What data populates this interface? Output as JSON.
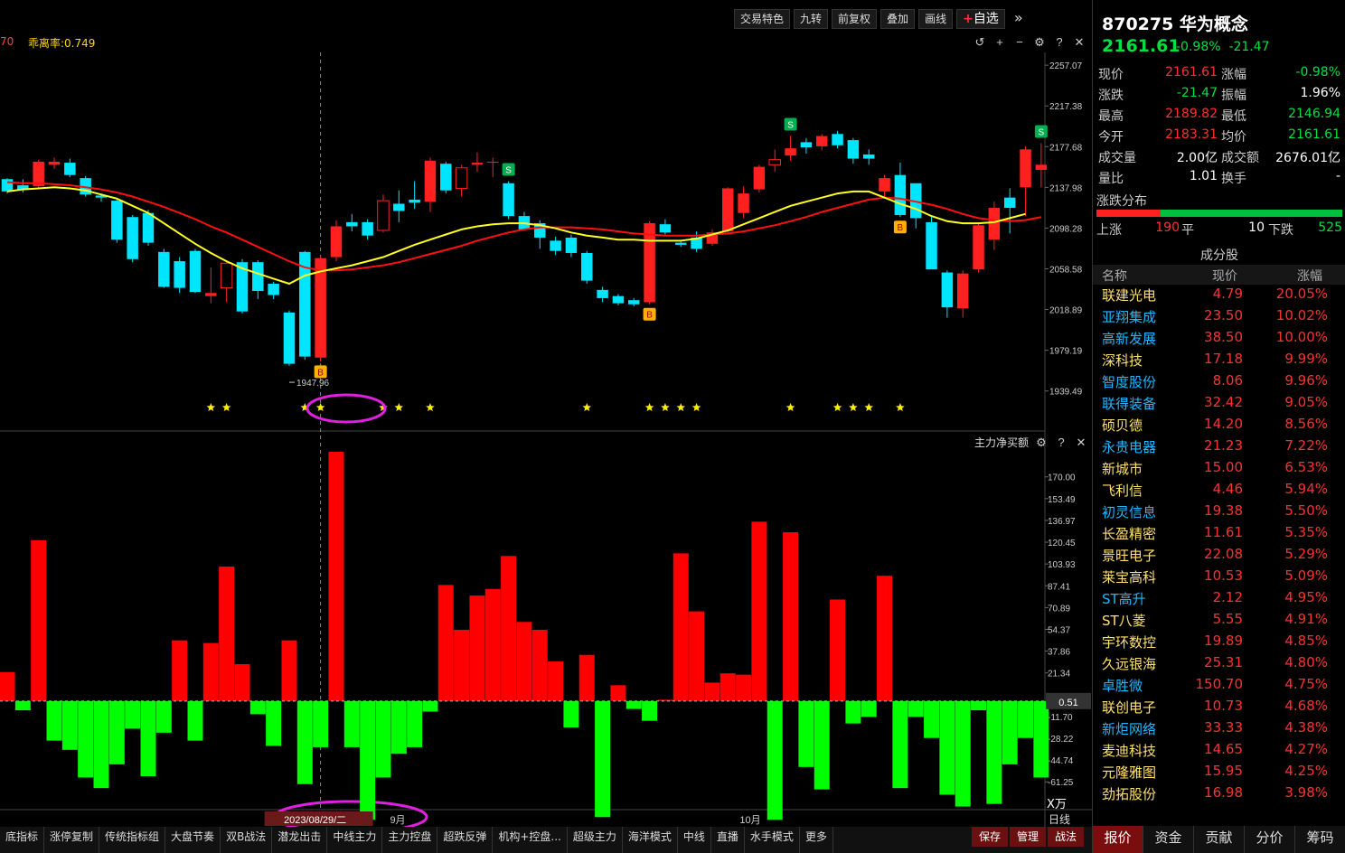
{
  "toolbar": {
    "items": [
      "交易特色",
      "九转",
      "前复权",
      "叠加",
      "画线"
    ],
    "fav_label": "自选",
    "more": "»"
  },
  "indicator_label": "乖离率:0.749",
  "indicator_prefix": "70",
  "volume_panel_label": "主力净买额",
  "date_selected": "2023/08/29/二",
  "month_labels": [
    "9月",
    "10月"
  ],
  "unit_label": "X万",
  "zero_label": "0.51",
  "period_label": "日线",
  "chart_data": [
    {
      "type": "candlestick",
      "y_ticks": [
        2257.07,
        2217.38,
        2177.68,
        2137.98,
        2098.28,
        2058.58,
        2018.89,
        1979.19,
        1939.49
      ],
      "ylim": [
        1926,
        2266
      ],
      "low_annotation": "1947.96",
      "ohlc": [
        [
          2146,
          2147,
          2132,
          2134
        ],
        [
          2140,
          2146,
          2133,
          2136
        ],
        [
          2139,
          2165,
          2137,
          2163
        ],
        [
          2160,
          2167,
          2156,
          2163
        ],
        [
          2162,
          2166,
          2148,
          2150
        ],
        [
          2147,
          2149,
          2129,
          2131
        ],
        [
          2130,
          2132,
          2124,
          2128
        ],
        [
          2125,
          2126,
          2084,
          2087
        ],
        [
          2109,
          2111,
          2065,
          2068
        ],
        [
          2113,
          2116,
          2081,
          2084
        ],
        [
          2075,
          2078,
          2040,
          2041
        ],
        [
          2066,
          2070,
          2035,
          2040
        ],
        [
          2076,
          2078,
          2035,
          2036
        ],
        [
          2032,
          2060,
          2025,
          2035
        ],
        [
          2040,
          2067,
          2026,
          2064
        ],
        [
          2065,
          2068,
          2015,
          2017
        ],
        [
          2065,
          2067,
          2029,
          2037
        ],
        [
          2044,
          2046,
          2029,
          2033
        ],
        [
          2016,
          2018,
          1964,
          1966
        ],
        [
          2075,
          2076,
          1970,
          1973
        ],
        [
          1972,
          2071,
          1968,
          2069
        ],
        [
          2070,
          2106,
          2066,
          2100
        ],
        [
          2104,
          2112,
          2095,
          2100
        ],
        [
          2104,
          2107,
          2087,
          2091
        ],
        [
          2096,
          2131,
          2094,
          2125
        ],
        [
          2122,
          2135,
          2104,
          2115
        ],
        [
          2126,
          2144,
          2117,
          2123
        ],
        [
          2124,
          2167,
          2114,
          2164
        ],
        [
          2161,
          2163,
          2132,
          2135
        ],
        [
          2137,
          2160,
          2129,
          2157
        ],
        [
          2160,
          2172,
          2153,
          2162
        ],
        [
          2163,
          2167,
          2148,
          2163
        ],
        [
          2142,
          2144,
          2107,
          2110
        ],
        [
          2110,
          2114,
          2096,
          2097
        ],
        [
          2103,
          2106,
          2078,
          2089
        ],
        [
          2086,
          2090,
          2072,
          2076
        ],
        [
          2089,
          2092,
          2070,
          2074
        ],
        [
          2074,
          2076,
          2044,
          2047
        ],
        [
          2038,
          2041,
          2026,
          2030
        ],
        [
          2032,
          2034,
          2023,
          2025
        ],
        [
          2028,
          2030,
          2022,
          2024
        ],
        [
          2026,
          2105,
          2024,
          2103
        ],
        [
          2102,
          2107,
          2092,
          2094
        ],
        [
          2084,
          2086,
          2080,
          2082
        ],
        [
          2089,
          2095,
          2075,
          2078
        ],
        [
          2083,
          2097,
          2081,
          2094
        ],
        [
          2095,
          2138,
          2093,
          2137
        ],
        [
          2113,
          2139,
          2108,
          2132
        ],
        [
          2136,
          2160,
          2133,
          2158
        ],
        [
          2160,
          2175,
          2153,
          2165
        ],
        [
          2169,
          2188,
          2164,
          2176
        ],
        [
          2182,
          2186,
          2171,
          2177
        ],
        [
          2178,
          2190,
          2174,
          2188
        ],
        [
          2190,
          2193,
          2176,
          2179
        ],
        [
          2184,
          2186,
          2161,
          2166
        ],
        [
          2170,
          2175,
          2160,
          2166
        ],
        [
          2134,
          2150,
          2127,
          2147
        ],
        [
          2150,
          2162,
          2109,
          2111
        ],
        [
          2142,
          2133,
          2098,
          2108
        ],
        [
          2104,
          2110,
          2060,
          2058
        ],
        [
          2055,
          2057,
          2011,
          2021
        ],
        [
          2020,
          2057,
          2011,
          2054
        ],
        [
          2058,
          2104,
          2055,
          2101
        ],
        [
          2087,
          2124,
          2077,
          2118
        ],
        [
          2128,
          2137,
          2093,
          2118
        ],
        [
          2138,
          2178,
          2110,
          2175
        ],
        [
          2155,
          2181,
          2138,
          2160
        ]
      ],
      "ma_yellow": [
        2134,
        2136,
        2137,
        2138,
        2137,
        2135,
        2131,
        2127,
        2120,
        2113,
        2103,
        2093,
        2083,
        2074,
        2066,
        2059,
        2054,
        2049,
        2044,
        2052,
        2056,
        2059,
        2062,
        2066,
        2070,
        2076,
        2082,
        2087,
        2092,
        2097,
        2100,
        2102,
        2103,
        2103,
        2101,
        2098,
        2094,
        2091,
        2089,
        2087,
        2087,
        2086,
        2086,
        2086,
        2088,
        2092,
        2096,
        2102,
        2108,
        2114,
        2120,
        2124,
        2128,
        2132,
        2134,
        2134,
        2128,
        2122,
        2117,
        2110,
        2105,
        2103,
        2103,
        2104,
        2108,
        2112
      ],
      "ma_red": [
        2143,
        2142,
        2142,
        2141,
        2140,
        2138,
        2136,
        2133,
        2129,
        2124,
        2119,
        2113,
        2107,
        2100,
        2094,
        2087,
        2080,
        2073,
        2066,
        2060,
        2057,
        2057,
        2058,
        2060,
        2062,
        2065,
        2069,
        2073,
        2077,
        2081,
        2086,
        2090,
        2094,
        2097,
        2099,
        2099,
        2099,
        2098,
        2097,
        2095,
        2093,
        2092,
        2091,
        2091,
        2091,
        2092,
        2093,
        2095,
        2098,
        2101,
        2105,
        2109,
        2114,
        2118,
        2122,
        2126,
        2128,
        2127,
        2124,
        2121,
        2117,
        2112,
        2108,
        2106,
        2105,
        2106,
        2109
      ],
      "signals": [
        {
          "i": 20,
          "tag": "B"
        },
        {
          "i": 32,
          "tag": "S"
        },
        {
          "i": 41,
          "tag": "B"
        },
        {
          "i": 50,
          "tag": "S"
        },
        {
          "i": 57,
          "tag": "B"
        },
        {
          "i": 66,
          "tag": "S"
        }
      ],
      "stars": [
        13,
        14,
        19,
        20,
        24,
        25,
        27,
        37,
        41,
        42,
        43,
        44,
        50,
        53,
        54,
        55,
        57
      ]
    },
    {
      "type": "bar",
      "y_ticks": [
        170.0,
        153.49,
        136.97,
        120.45,
        103.93,
        87.41,
        70.89,
        54.37,
        37.86,
        21.34,
        -11.7,
        -28.22,
        -44.74,
        -61.25
      ],
      "ylim": [
        -70,
        189
      ],
      "values": [
        22,
        -7,
        122,
        -30,
        -37,
        -58,
        -66,
        -48,
        -21,
        -57,
        -24,
        46,
        -30,
        44,
        102,
        28,
        -10,
        -34,
        46,
        -63,
        -35,
        189,
        -35,
        -90,
        -58,
        -40,
        -35,
        -8,
        88,
        54,
        80,
        85,
        110,
        60,
        54,
        30,
        -20,
        35,
        -88,
        12,
        -6,
        -15,
        1,
        112,
        68,
        14,
        21,
        20,
        136,
        -90,
        128,
        -50,
        -67,
        77,
        -17,
        -12,
        95,
        -66,
        -12,
        -28,
        -71,
        -80,
        -7,
        -78,
        -48,
        -28,
        -58
      ]
    }
  ],
  "quote": {
    "code_name": "870275 华为概念",
    "price": "2161.61",
    "chg_pct": "-0.98%",
    "chg": "-21.47",
    "rows": [
      [
        "现价",
        "2161.61",
        "涨幅",
        "-0.98%"
      ],
      [
        "涨跌",
        "-21.47",
        "振幅",
        "1.96%"
      ],
      [
        "最高",
        "2189.82",
        "最低",
        "2146.94"
      ],
      [
        "今开",
        "2183.31",
        "均价",
        "2161.61"
      ],
      [
        "成交量",
        "2.00亿",
        "成交额",
        "2676.01亿"
      ],
      [
        "量比",
        "1.01",
        "换手",
        "-"
      ]
    ],
    "dist_title": "涨跌分布",
    "up_label": "上涨",
    "up": "190",
    "flat_label": "平",
    "flat": "10",
    "down_label": "下跌",
    "down": "525"
  },
  "components": {
    "title": "成分股",
    "headers": [
      "名称",
      "现价",
      "涨幅"
    ],
    "rows": [
      [
        "联建光电",
        "4.79",
        "20.05%",
        "yellow"
      ],
      [
        "亚翔集成",
        "23.50",
        "10.02%",
        "cyan"
      ],
      [
        "高新发展",
        "38.50",
        "10.00%",
        "cyan"
      ],
      [
        "深科技",
        "17.18",
        "9.99%",
        "yellow"
      ],
      [
        "智度股份",
        "8.06",
        "9.96%",
        "cyan"
      ],
      [
        "联得装备",
        "32.42",
        "9.05%",
        "cyan"
      ],
      [
        "硕贝德",
        "14.20",
        "8.56%",
        "yellow"
      ],
      [
        "永贵电器",
        "21.23",
        "7.22%",
        "cyan"
      ],
      [
        "新城市",
        "15.00",
        "6.53%",
        "yellow"
      ],
      [
        "飞利信",
        "4.46",
        "5.94%",
        "yellow"
      ],
      [
        "初灵信息",
        "19.38",
        "5.50%",
        "cyan"
      ],
      [
        "长盈精密",
        "11.61",
        "5.35%",
        "yellow"
      ],
      [
        "景旺电子",
        "22.08",
        "5.29%",
        "yellow"
      ],
      [
        "莱宝高科",
        "10.53",
        "5.09%",
        "yellow"
      ],
      [
        "ST高升",
        "2.12",
        "4.95%",
        "cyan"
      ],
      [
        "ST八菱",
        "5.55",
        "4.91%",
        "yellow"
      ],
      [
        "宇环数控",
        "19.89",
        "4.85%",
        "yellow"
      ],
      [
        "久远银海",
        "25.31",
        "4.80%",
        "yellow"
      ],
      [
        "卓胜微",
        "150.70",
        "4.75%",
        "cyan"
      ],
      [
        "联创电子",
        "10.73",
        "4.68%",
        "yellow"
      ],
      [
        "新炬网络",
        "33.33",
        "4.38%",
        "cyan"
      ],
      [
        "麦迪科技",
        "14.65",
        "4.27%",
        "yellow"
      ],
      [
        "元隆雅图",
        "15.95",
        "4.25%",
        "yellow"
      ],
      [
        "劲拓股份",
        "16.98",
        "3.98%",
        "yellow"
      ]
    ]
  },
  "bottom_tabs": [
    "底指标",
    "涨停复制",
    "传统指标组",
    "大盘节奏",
    "双B战法",
    "潜龙出击",
    "中线主力",
    "主力控盘",
    "超跌反弹",
    "机构+控盘...",
    "超级主力",
    "海洋模式",
    "中线",
    "直播",
    "水手模式",
    "更多"
  ],
  "bottom_buttons": [
    "保存",
    "管理",
    "战法"
  ],
  "right_tabs": [
    "报价",
    "资金",
    "贡献",
    "分价",
    "筹码"
  ]
}
